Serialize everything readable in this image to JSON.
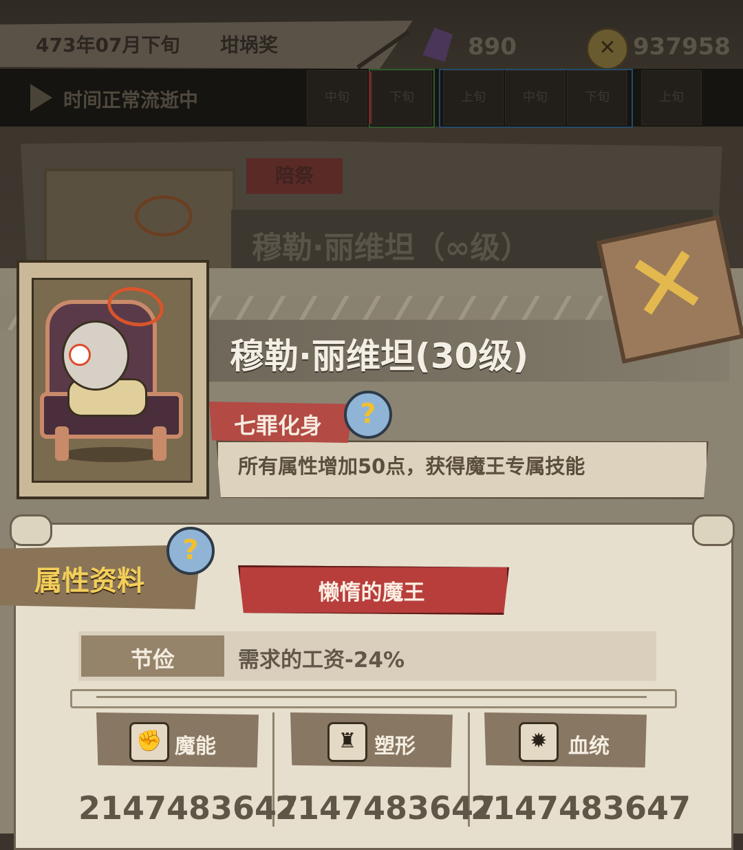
{
  "header": {
    "date": "473年07月下旬",
    "title": "坩埚奖",
    "gems": "890",
    "gold": "937958"
  },
  "time_bar": {
    "status": "时间正常流逝中",
    "cells": [
      "中旬",
      "下旬",
      "上旬",
      "中旬",
      "下旬",
      "上旬"
    ]
  },
  "background_card": {
    "tag": "陪祭",
    "name": "穆勒·丽维坦（∞级）"
  },
  "character": {
    "name": "穆勒·丽维坦(30级)",
    "trait_name": "七罪化身",
    "trait_desc": "所有属性增加50点，获得魔王专属技能"
  },
  "attributes": {
    "section_title": "属性资料",
    "banner": "懒惰的魔王",
    "trait_label": "节俭",
    "trait_effect": "需求的工资-24%",
    "stats": [
      {
        "label": "魔能",
        "value": "2147483647",
        "icon": "demon-energy-icon"
      },
      {
        "label": "塑形",
        "value": "2147483647",
        "icon": "body-shape-icon"
      },
      {
        "label": "血统",
        "value": "2147483647",
        "icon": "bloodline-icon"
      }
    ]
  },
  "colors": {
    "accent_red": "#b83e3c",
    "gold_text": "#f3cf5a",
    "help_blue": "#8fb4d6"
  }
}
